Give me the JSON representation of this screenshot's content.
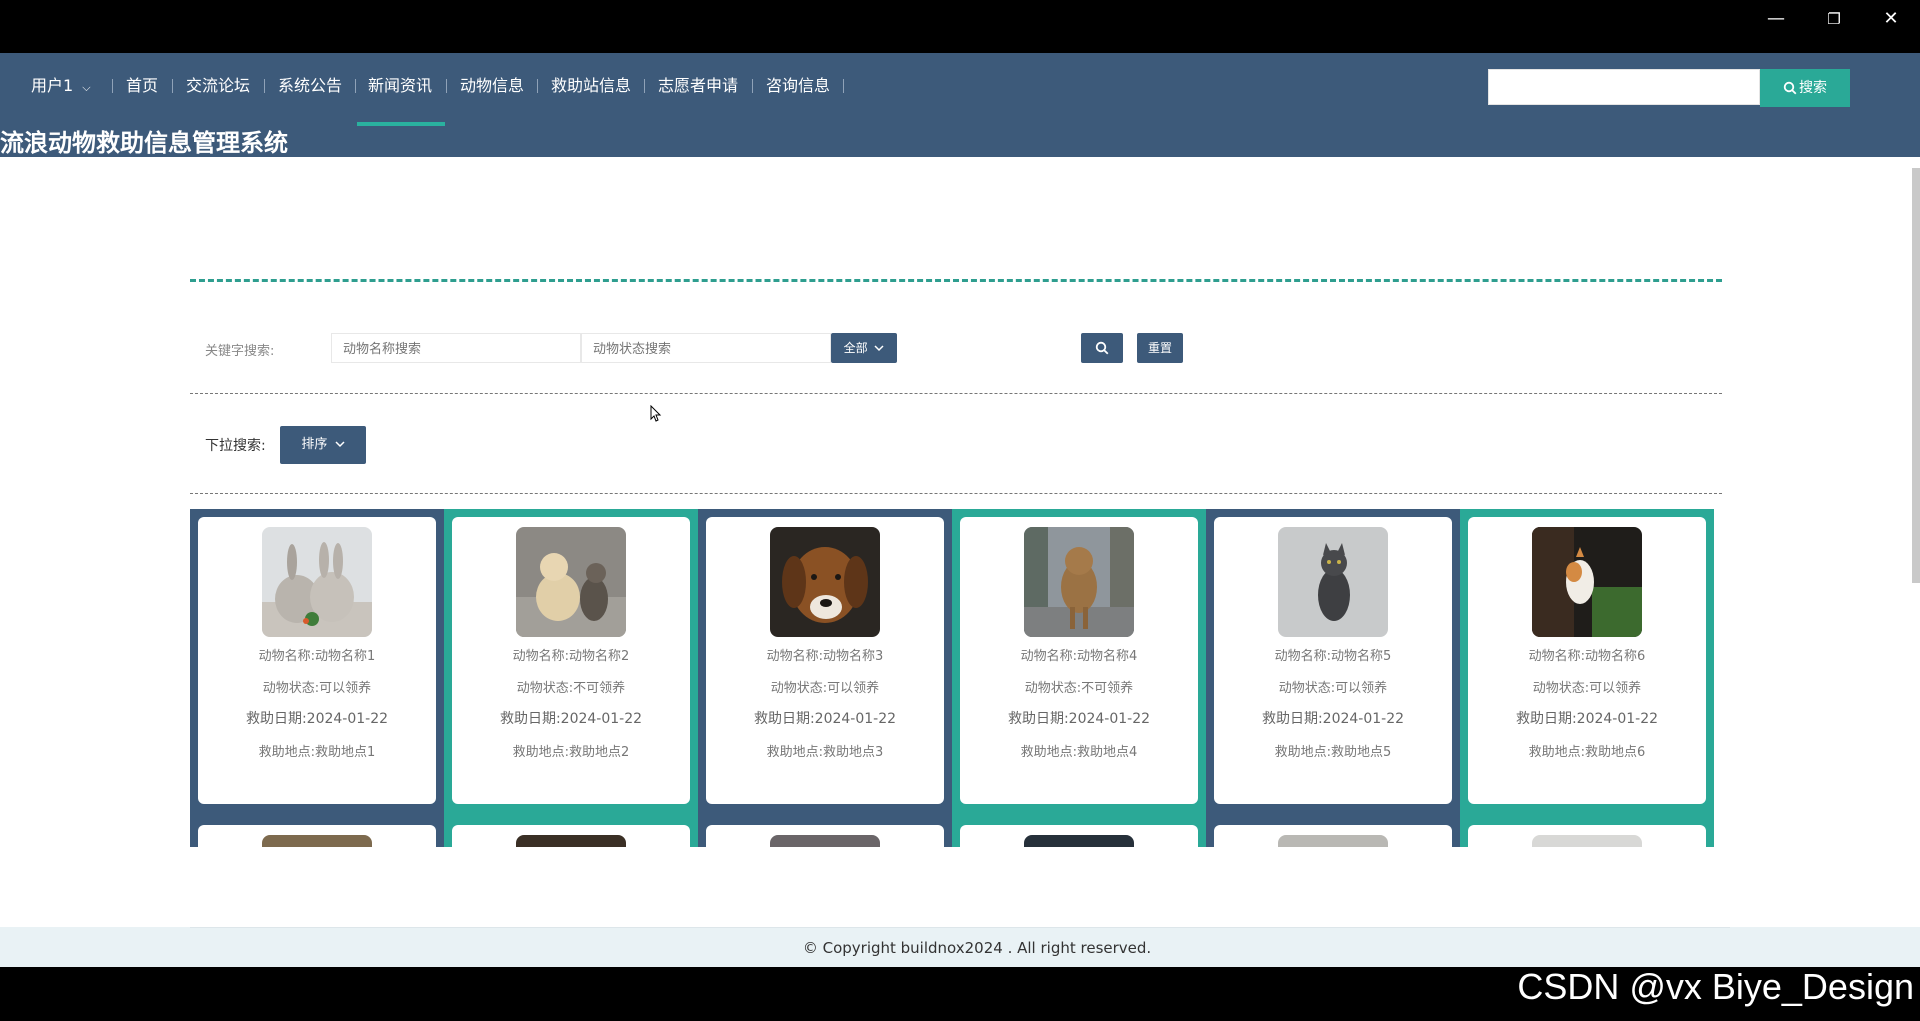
{
  "window": {
    "minimize": "—",
    "restore": "❐",
    "close": "✕"
  },
  "nav": {
    "user": "用户1",
    "items": [
      "首页",
      "交流论坛",
      "系统公告",
      "新闻资讯",
      "动物信息",
      "救助站信息",
      "志愿者申请",
      "咨询信息"
    ],
    "active_index": 3,
    "search_button": "搜索",
    "search_value": ""
  },
  "site_title": "流浪动物救助信息管理系统",
  "filters": {
    "keyword_label": "关键字搜索:",
    "name_placeholder": "动物名称搜索",
    "status_placeholder": "动物状态搜索",
    "select_value": "全部",
    "reset_label": "重置",
    "dropdown_label": "下拉搜索:",
    "sort_label": "排序"
  },
  "animals": [
    {
      "name": "动物名称:动物名称1",
      "status": "动物状态:可以领养",
      "date": "救助日期:2024-01-22",
      "place": "救助地点:救助地点1",
      "photo": "rabbits"
    },
    {
      "name": "动物名称:动物名称2",
      "status": "动物状态:不可领养",
      "date": "救助日期:2024-01-22",
      "place": "救助地点:救助地点2",
      "photo": "puppies"
    },
    {
      "name": "动物名称:动物名称3",
      "status": "动物状态:可以领养",
      "date": "救助日期:2024-01-22",
      "place": "救助地点:救助地点3",
      "photo": "brown-dog"
    },
    {
      "name": "动物名称:动物名称4",
      "status": "动物状态:不可领养",
      "date": "救助日期:2024-01-22",
      "place": "救助地点:救助地点4",
      "photo": "street-dog"
    },
    {
      "name": "动物名称:动物名称5",
      "status": "动物状态:可以领养",
      "date": "救助日期:2024-01-22",
      "place": "救助地点:救助地点5",
      "photo": "gray-cat"
    },
    {
      "name": "动物名称:动物名称6",
      "status": "动物状态:可以领养",
      "date": "救助日期:2024-01-22",
      "place": "救助地点:救助地点6",
      "photo": "calico-cat"
    }
  ],
  "footer": {
    "copyright": "© Copyright buildnox2024 . All right reserved."
  },
  "watermark": "CSDN @vx Biye_Design",
  "colors": {
    "nav": "#3d5a7a",
    "accent": "#2aa997"
  }
}
